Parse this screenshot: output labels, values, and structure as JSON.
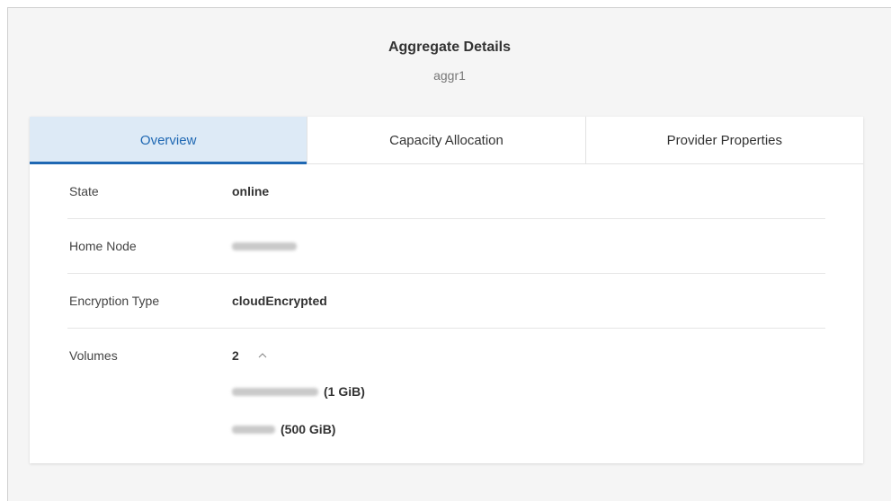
{
  "header": {
    "title": "Aggregate Details",
    "subtitle": "aggr1"
  },
  "tabs": [
    {
      "label": "Overview",
      "active": true
    },
    {
      "label": "Capacity Allocation",
      "active": false
    },
    {
      "label": "Provider Properties",
      "active": false
    }
  ],
  "overview": {
    "state": {
      "label": "State",
      "value": "online"
    },
    "home_node": {
      "label": "Home Node",
      "value": ""
    },
    "encryption": {
      "label": "Encryption Type",
      "value": "cloudEncrypted"
    },
    "volumes": {
      "label": "Volumes",
      "count": "2",
      "items": [
        {
          "name": "",
          "size": "(1 GiB)"
        },
        {
          "name": "",
          "size": "(500 GiB)"
        }
      ]
    }
  },
  "colors": {
    "accent": "#1f68b3",
    "active_tab_bg": "#ddeaf6"
  },
  "icons": {
    "expand_toggle": "chevron-up-icon"
  }
}
